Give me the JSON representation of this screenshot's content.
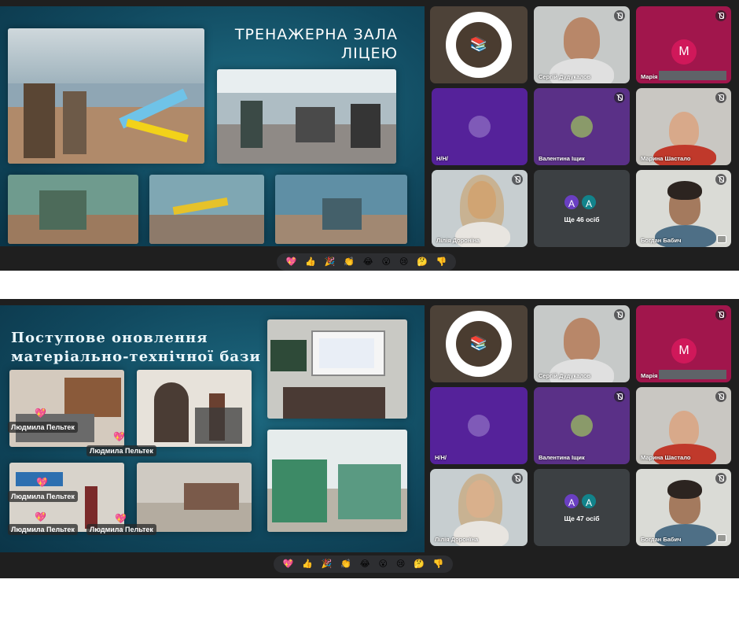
{
  "shot1": {
    "slide_title_line1": "ТРЕНАЖЕРНА ЗАЛА",
    "slide_title_line2": "ЛІЦЕЮ",
    "participants": {
      "p1": "Сергій Дудукалов",
      "p2": "Марія",
      "p2_initial": "M",
      "p3": "Н/Н/",
      "p4": "Валентина Іщик",
      "p5": "Марина Шастало",
      "p6": "Лілія Дороніна",
      "p7": "Богдан Бабич"
    },
    "more": {
      "initial_a": "A",
      "initial_b": "A",
      "text": "Ще 46 осіб"
    }
  },
  "shot2": {
    "slide_title_line1": "Поступове оновлення",
    "slide_title_line2": "матеріально-технічної бази",
    "annotation_label": "Людмила Пельтек",
    "participants": {
      "p1": "Сергій Дудукалов",
      "p2": "Марія",
      "p2_initial": "M",
      "p3": "Н/Н/",
      "p4": "Валентина Іщик",
      "p5": "Марина Шастало",
      "p6": "Лілія Доронїна",
      "p7": "Богдан Бабич"
    },
    "more": {
      "initial_a": "A",
      "initial_b": "A",
      "text": "Ще 47 осіб"
    }
  },
  "reactions": [
    "💖",
    "👍",
    "🎉",
    "👏",
    "😂",
    "😮",
    "😢",
    "🤔",
    "👎"
  ],
  "colors": {
    "slide_bg": "#114a60",
    "avatar_marija": "#d0185a",
    "avatar_a1": "#6a3fc2",
    "avatar_a2": "#12838b",
    "tile_bg": "#3c4043",
    "purple_tile": "#5b2a9e"
  },
  "icons": [
    "mic-off-icon",
    "camera-flip-icon",
    "heart-reaction-icon"
  ]
}
